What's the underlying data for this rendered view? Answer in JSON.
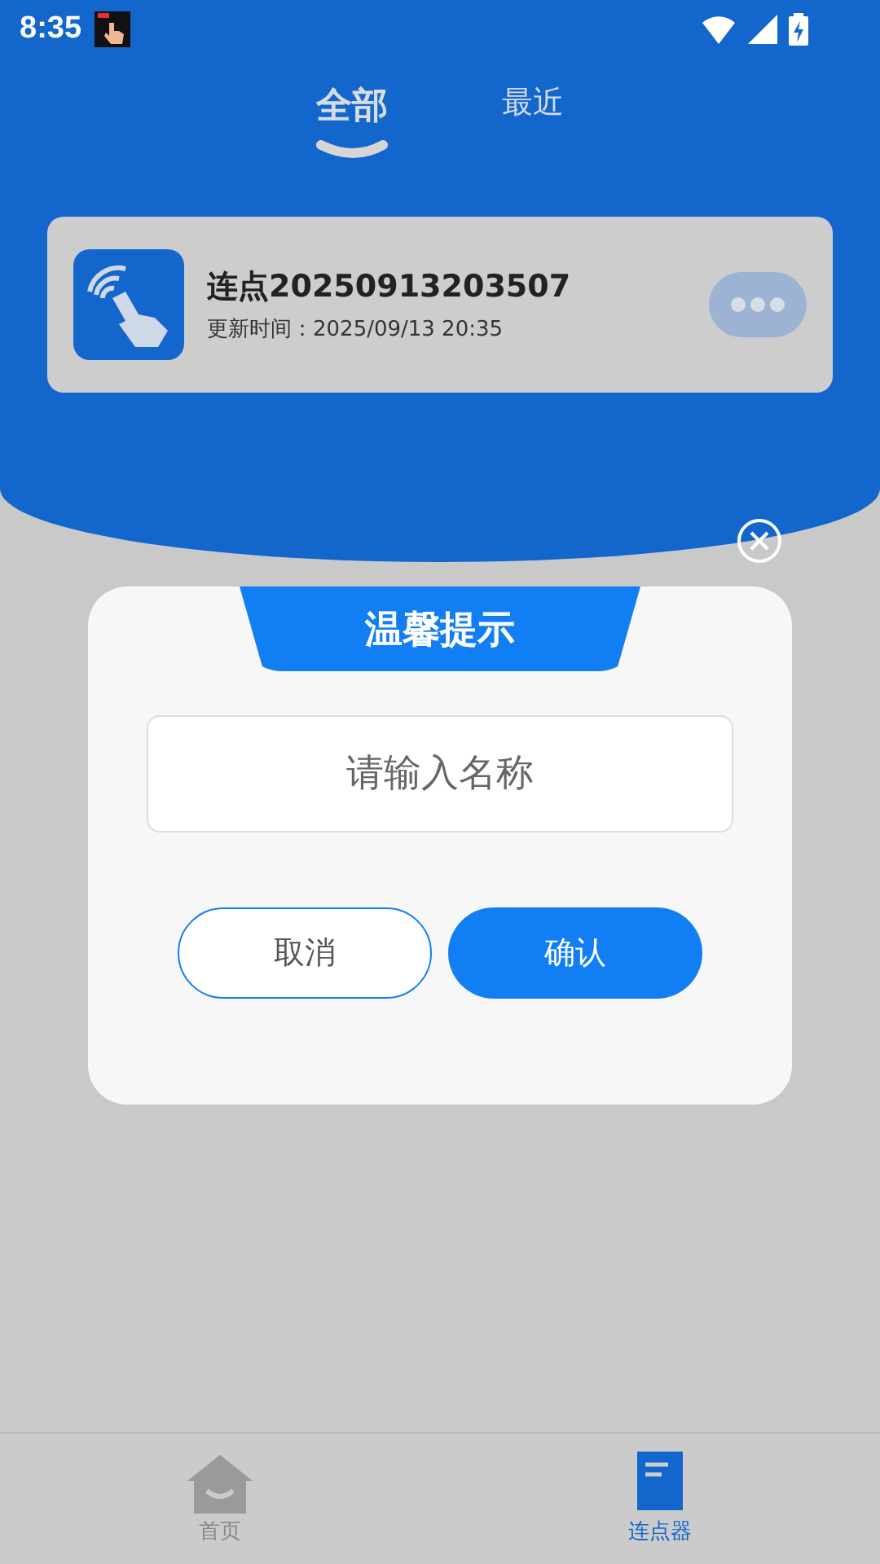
{
  "status_bar": {
    "time": "8:35"
  },
  "tabs": [
    {
      "label": "全部",
      "selected": true
    },
    {
      "label": "最近",
      "selected": false
    }
  ],
  "records": [
    {
      "name": "连点20250913203507",
      "updated": "更新时间：2025/09/13 20:35"
    }
  ],
  "dialog": {
    "title": "温馨提示",
    "name_field": {
      "placeholder": "请输入名称"
    },
    "buttons": [
      {
        "label": "取消",
        "kind": "secondary"
      },
      {
        "label": "确认",
        "kind": "primary"
      }
    ]
  },
  "nav": [
    {
      "label": "首页",
      "selected": false
    },
    {
      "label": "连点器",
      "selected": true
    }
  ]
}
